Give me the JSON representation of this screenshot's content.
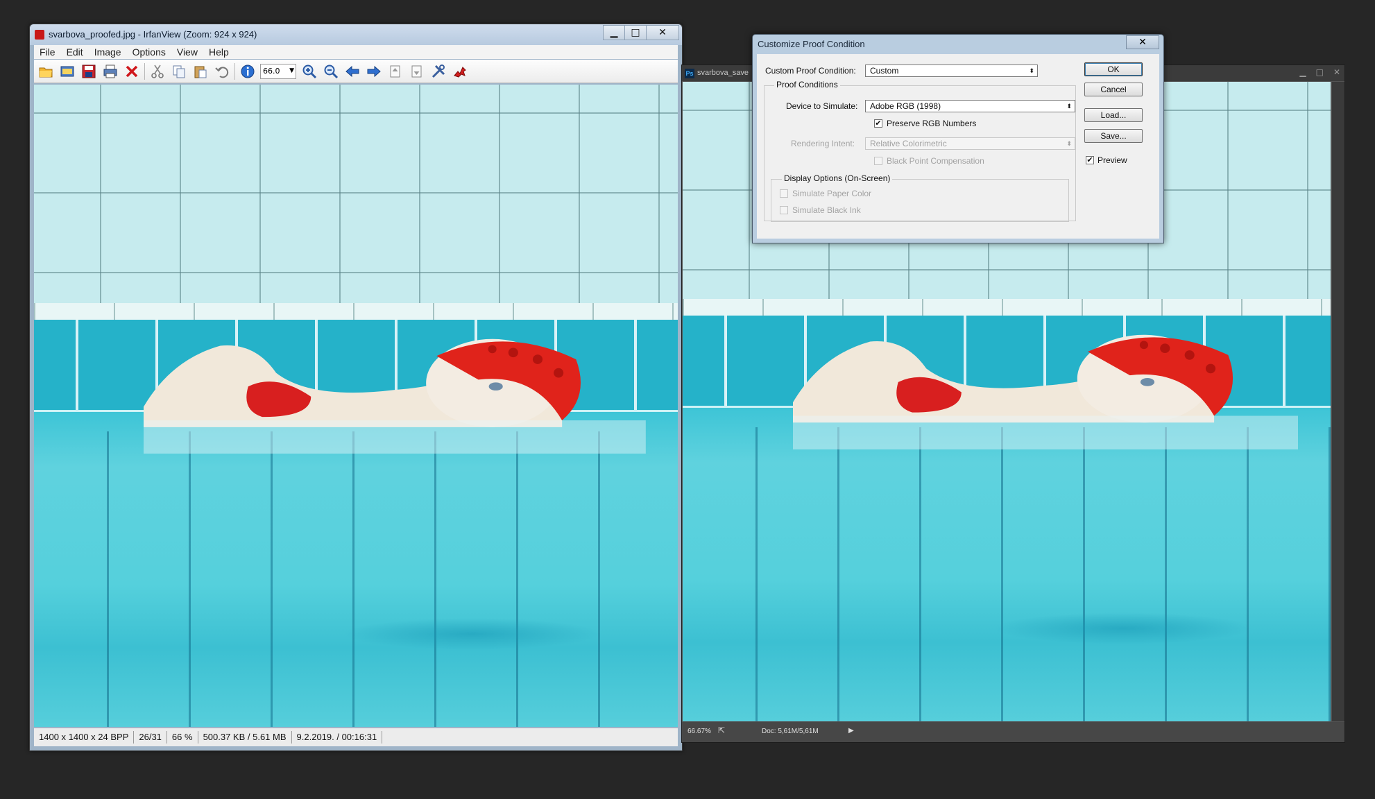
{
  "irfanview": {
    "title": "svarbova_proofed.jpg - IrfanView (Zoom: 924 x 924)",
    "window_buttons": {
      "minimize": "▁",
      "maximize": "□",
      "close": "✕"
    },
    "menu": [
      "File",
      "Edit",
      "Image",
      "Options",
      "View",
      "Help"
    ],
    "toolbar": {
      "icons": [
        "open-folder-icon",
        "slideshow-icon",
        "save-icon",
        "print-icon",
        "delete-icon",
        "cut-icon",
        "copy-icon",
        "paste-icon",
        "undo-icon",
        "info-icon",
        "zoom-in-icon",
        "zoom-out-icon",
        "previous-icon",
        "next-icon",
        "first-page-icon",
        "last-page-icon",
        "settings-icon",
        "irfanview-logo-icon"
      ],
      "zoom_value": "66.0"
    },
    "status": {
      "dimensions": "1400 x 1400 x 24 BPP",
      "index": "26/31",
      "zoom": "66 %",
      "size": "500.37 KB / 5.61 MB",
      "datetime": "9.2.2019. / 00:16:31"
    }
  },
  "photoshop": {
    "tab_title": "svarbova_save",
    "status": {
      "zoom": "66.67%",
      "doc": "Doc: 5,61M/5,61M"
    }
  },
  "dialog": {
    "title": "Customize Proof Condition",
    "close": "✕",
    "custom_label": "Custom Proof Condition:",
    "custom_value": "Custom",
    "proof_conditions_title": "Proof Conditions",
    "device_label": "Device to Simulate:",
    "device_value": "Adobe RGB (1998)",
    "preserve_rgb": {
      "label": "Preserve RGB Numbers",
      "checked": true
    },
    "rendering_label": "Rendering Intent:",
    "rendering_value": "Relative Colorimetric",
    "black_point": {
      "label": "Black Point Compensation",
      "checked": false
    },
    "display_options_title": "Display Options (On-Screen)",
    "simulate_paper": {
      "label": "Simulate Paper Color",
      "checked": false
    },
    "simulate_ink": {
      "label": "Simulate Black Ink",
      "checked": false
    },
    "buttons": {
      "ok": "OK",
      "cancel": "Cancel",
      "load": "Load...",
      "save": "Save..."
    },
    "preview": {
      "label": "Preview",
      "checked": true
    }
  },
  "colors": {
    "desktop": "#262626",
    "pool_wall": "#c6ebee",
    "pool_tiles": "#25b2c9",
    "swim_cap": "#e0231b"
  }
}
